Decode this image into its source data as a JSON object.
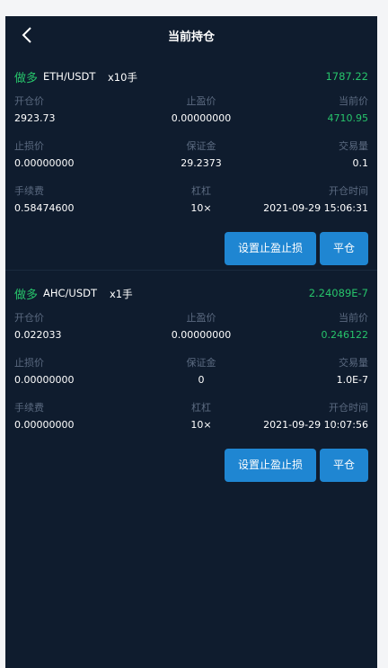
{
  "header": {
    "title": "当前持仓"
  },
  "positions": [
    {
      "side": "做多",
      "symbol": "ETH/USDT",
      "leverage": "x10手",
      "pnl": "1787.22",
      "open_price_label": "开仓价",
      "open_price": "2923.73",
      "take_profit_label": "止盈价",
      "take_profit": "0.00000000",
      "current_price_label": "当前价",
      "current_price": "4710.95",
      "stop_loss_label": "止损价",
      "stop_loss": "0.00000000",
      "margin_label": "保证金",
      "margin": "29.2373",
      "volume_label": "交易量",
      "volume": "0.1",
      "fee_label": "手续费",
      "fee": "0.58474600",
      "leverage_label": "杠杠",
      "leverage_value": "10×",
      "open_time_label": "开仓时间",
      "open_time": "2021-09-29 15:06:31",
      "set_tp_sl_label": "设置止盈止损",
      "close_label": "平仓"
    },
    {
      "side": "做多",
      "symbol": "AHC/USDT",
      "leverage": "x1手",
      "pnl": "2.24089E-7",
      "open_price_label": "开仓价",
      "open_price": "0.022033",
      "take_profit_label": "止盈价",
      "take_profit": "0.00000000",
      "current_price_label": "当前价",
      "current_price": "0.246122",
      "stop_loss_label": "止损价",
      "stop_loss": "0.00000000",
      "margin_label": "保证金",
      "margin": "0",
      "volume_label": "交易量",
      "volume": "1.0E-7",
      "fee_label": "手续费",
      "fee": "0.00000000",
      "leverage_label": "杠杠",
      "leverage_value": "10×",
      "open_time_label": "开仓时间",
      "open_time": "2021-09-29 10:07:56",
      "set_tp_sl_label": "设置止盈止损",
      "close_label": "平仓"
    }
  ]
}
